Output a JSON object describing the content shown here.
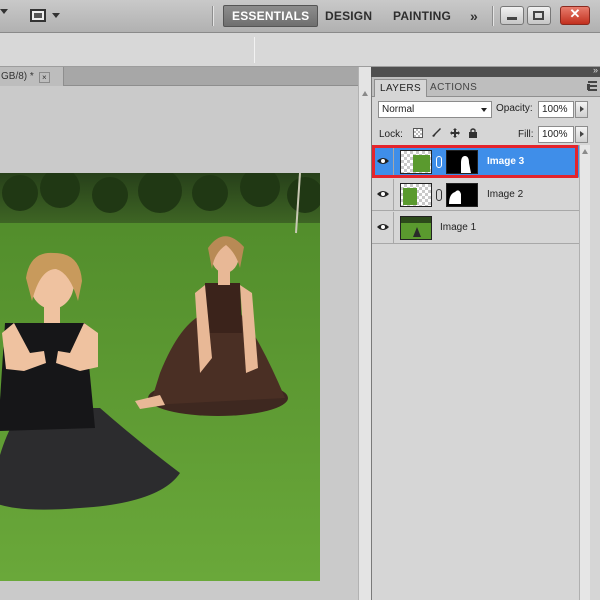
{
  "workspace": {
    "buttons": [
      "ESSENTIALS",
      "DESIGN",
      "PAINTING"
    ],
    "more_glyph": "»",
    "active": "ESSENTIALS"
  },
  "window_controls": {
    "close_glyph": "✕"
  },
  "document": {
    "tab_label": "GB/8) *",
    "tab_close_glyph": "×"
  },
  "layers_panel": {
    "tabs": [
      "LAYERS",
      "ACTIONS"
    ],
    "blend_mode": "Normal",
    "opacity_label": "Opacity:",
    "opacity_value": "100%",
    "lock_label": "Lock:",
    "fill_label": "Fill:",
    "fill_value": "100%",
    "layers": [
      {
        "name": "Image 3",
        "selected": true,
        "has_mask": true,
        "visible": true
      },
      {
        "name": "Image 2",
        "selected": false,
        "has_mask": true,
        "visible": true
      },
      {
        "name": "Image 1",
        "selected": false,
        "has_mask": false,
        "visible": true
      }
    ]
  },
  "colors": {
    "selection_blue": "#3f8ee9",
    "highlight_red": "#e4242c",
    "grass_green": "#5a9a2e"
  },
  "icons": [
    "tool-preset-icon",
    "screen-mode-icon",
    "eye-icon",
    "chain-link-icon",
    "lock-transparent-icon",
    "brush-icon",
    "move-icon",
    "lock-icon",
    "panel-menu-icon",
    "collapse-chevron-icon"
  ]
}
